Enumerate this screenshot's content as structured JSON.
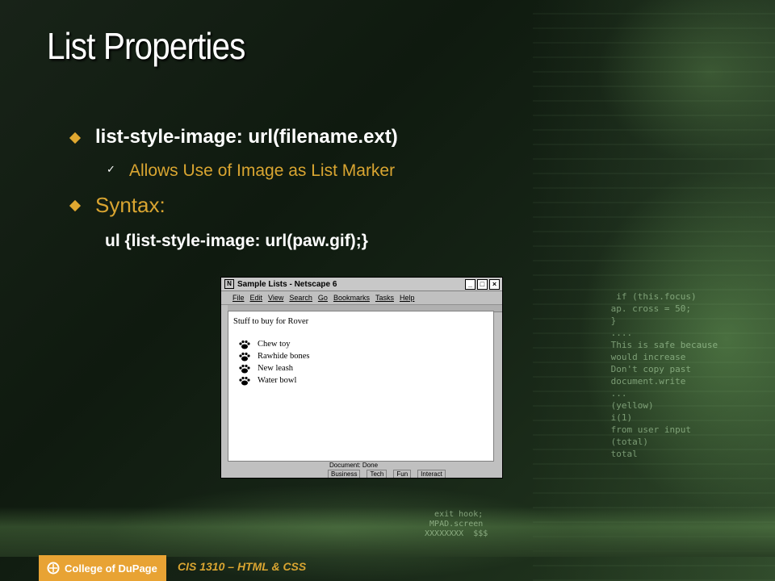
{
  "slide": {
    "title": "List Properties",
    "bullets": [
      {
        "text": "list-style-image: url(filename.ext)"
      },
      {
        "text": "Allows Use of Image as List Marker"
      },
      {
        "text": "Syntax:"
      },
      {
        "text": "ul {list-style-image: url(paw.gif);}"
      }
    ]
  },
  "screenshot": {
    "window_title": "Sample Lists - Netscape 6",
    "menu": [
      "File",
      "Edit",
      "View",
      "Search",
      "Go",
      "Bookmarks",
      "Tasks",
      "Help"
    ],
    "heading": "Stuff to buy for Rover",
    "items": [
      "Chew toy",
      "Rawhide bones",
      "New leash",
      "Water bowl"
    ],
    "status": "Document: Done",
    "tabs": [
      "Business",
      "Tech",
      "Fun",
      "Interact"
    ]
  },
  "footer": {
    "logo_text": "College of DuPage",
    "course": "CIS 1310 – HTML & CSS"
  },
  "colors": {
    "accent": "#d9a531",
    "logo_bg": "#e8a334",
    "title": "#ffffff"
  }
}
